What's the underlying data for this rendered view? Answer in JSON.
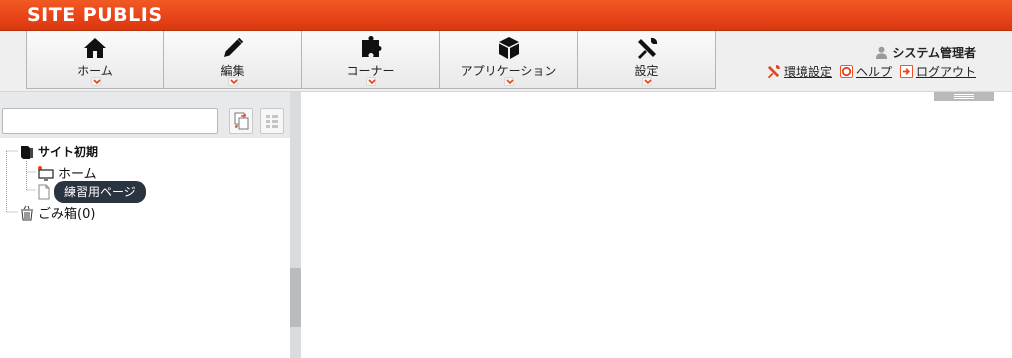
{
  "header": {
    "title": "SITE PUBLIS"
  },
  "menu": {
    "items": [
      {
        "label": "ホーム",
        "icon": "home-icon"
      },
      {
        "label": "編集",
        "icon": "pencil-icon"
      },
      {
        "label": "コーナー",
        "icon": "puzzle-icon"
      },
      {
        "label": "アプリケーション",
        "icon": "cube-icon"
      },
      {
        "label": "設定",
        "icon": "tools-icon"
      }
    ]
  },
  "user": {
    "name": "システム管理者",
    "links": {
      "settings": "環境設定",
      "help": "ヘルプ",
      "logout": "ログアウト"
    }
  },
  "sidebar": {
    "search": {
      "placeholder": "",
      "value": ""
    }
  },
  "tree": {
    "root": "サイト初期",
    "children": [
      {
        "label": "ホーム"
      },
      {
        "label": "練習用ページ"
      }
    ],
    "trash": "ごみ箱(0)"
  },
  "colors": {
    "accent": "#e8441a",
    "tooltip": "#2a3340"
  }
}
